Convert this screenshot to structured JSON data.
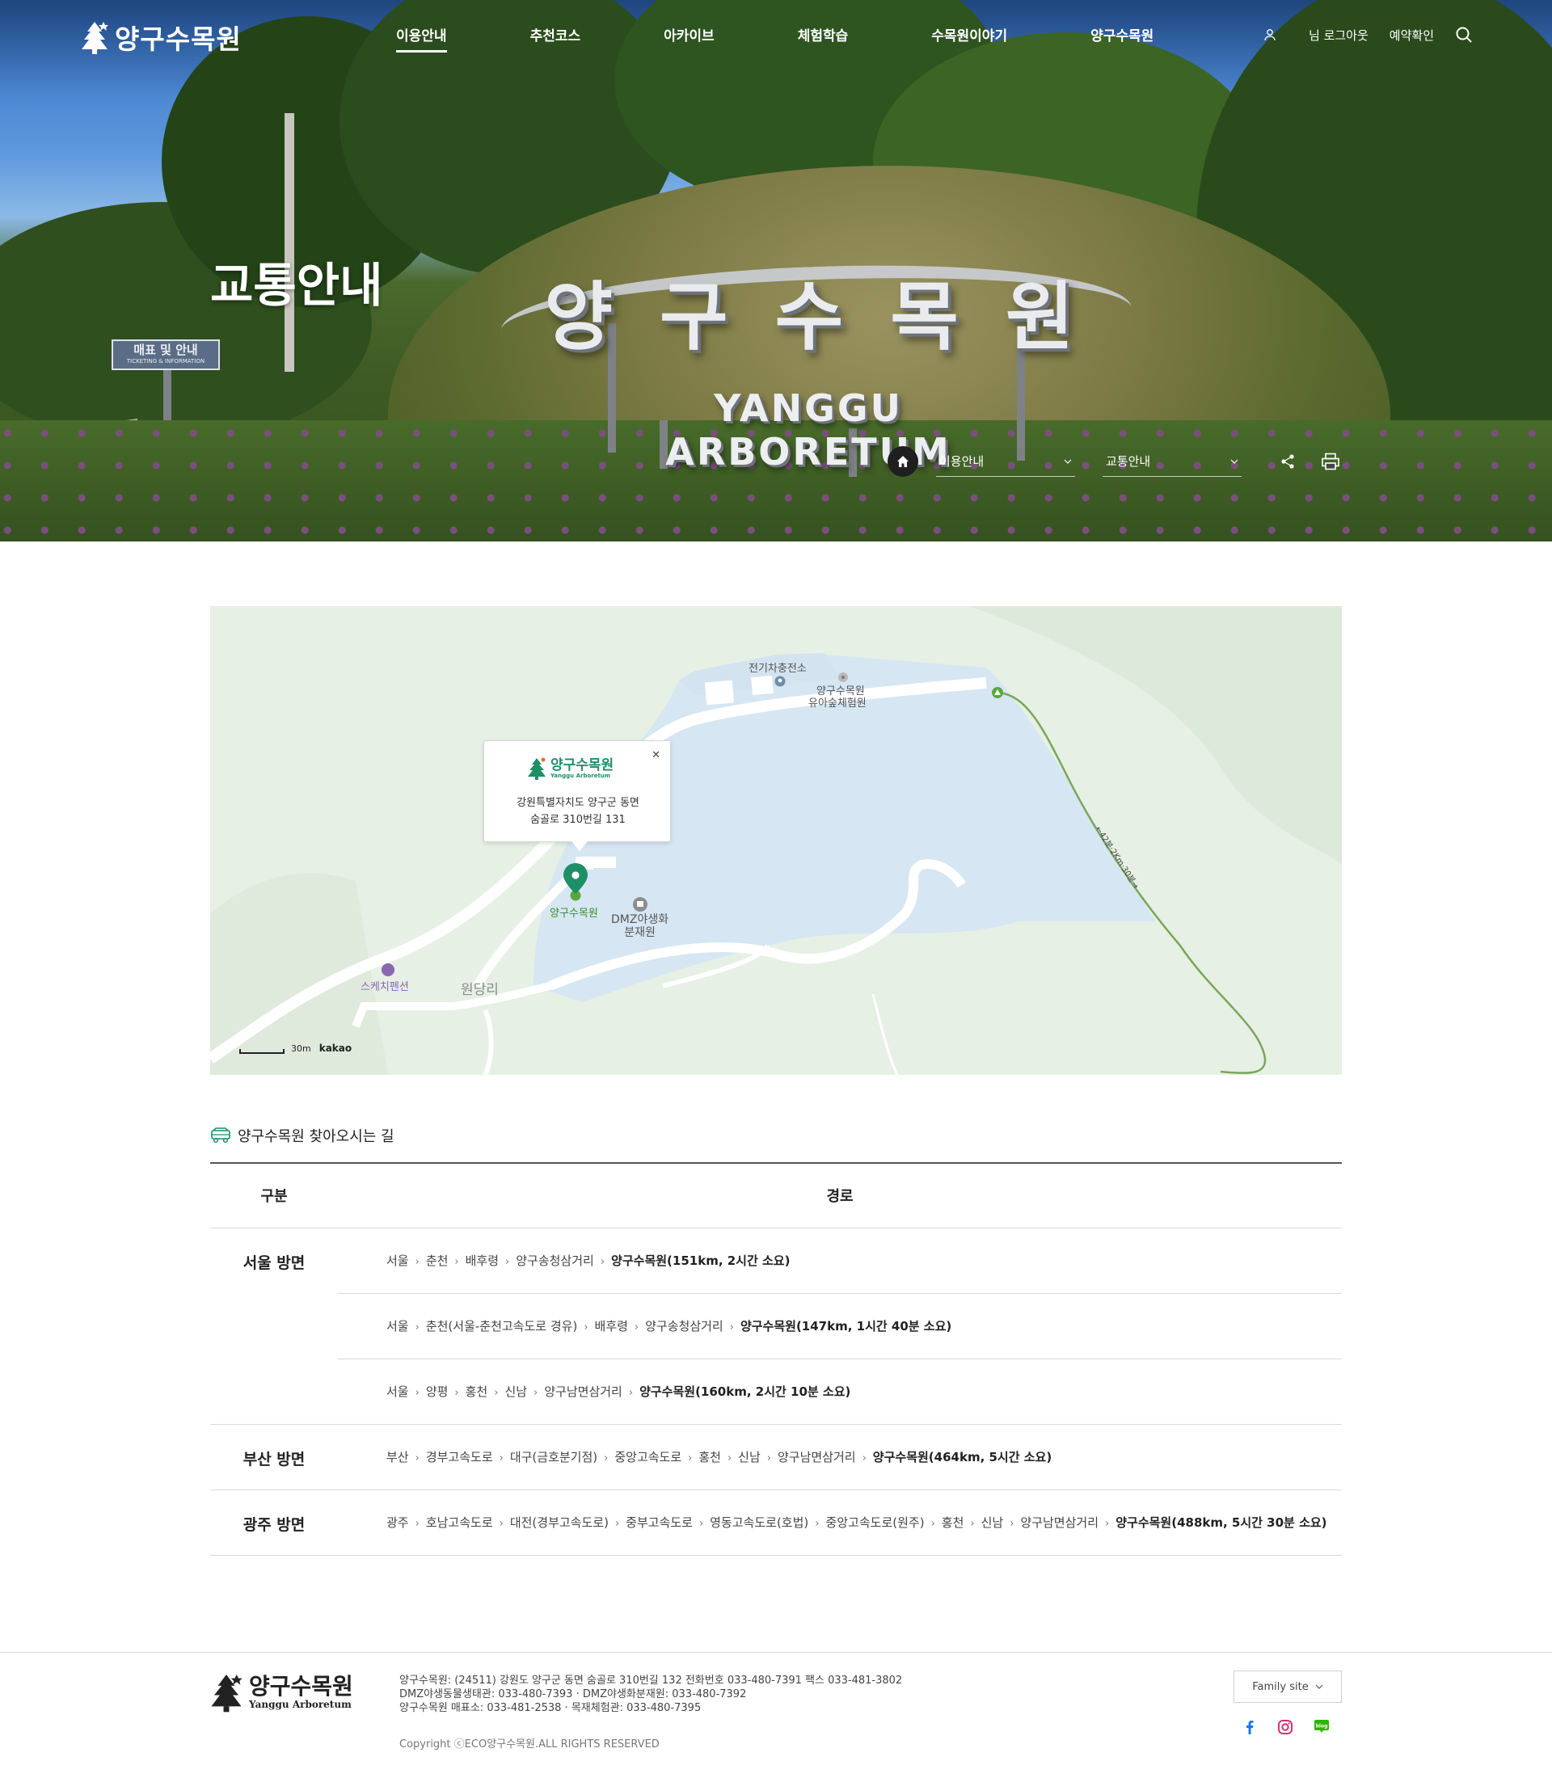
{
  "header": {
    "logo_text": "양구수목원",
    "nav": [
      "이용안내",
      "추천코스",
      "아카이브",
      "체험학습",
      "수목원이야기",
      "양구수목원"
    ],
    "active_nav": "이용안내",
    "util": {
      "logout": "님 로그아웃",
      "reservation": "예약확인"
    }
  },
  "hero": {
    "title": "교통안내",
    "sign_korean": "양구수목원",
    "sign_english": "YANGGU ARBORETUM",
    "road_sign_ko": "매표 및 안내",
    "road_sign_en": "TICKETING & INFORMATION"
  },
  "breadcrumb": {
    "level1": "이용안내",
    "level2": "교통안내"
  },
  "map": {
    "popup": {
      "logo_title": "양구수목원",
      "logo_sub": "Yanggu Arboretum",
      "address_line1": "강원특별자치도 양구군 동면",
      "address_line2": "숨골로 310번길 131"
    },
    "labels": {
      "charger": "전기차충전소",
      "forest_school_1": "양구수목원",
      "forest_school_2": "유아숲체험원",
      "arboretum": "양구수목원",
      "dmz_1": "DMZ야생화",
      "dmz_2": "분재원",
      "pension": "스케치펜션",
      "village": "원당리",
      "trail": "←42분·2Km·30분→"
    },
    "scale_text": "30m",
    "provider": "kakao"
  },
  "routes": {
    "section_title": "양구수목원 찾아오시는 길",
    "col_region": "구분",
    "col_path": "경로",
    "rows": [
      {
        "region": "서울 방면",
        "steps": [
          "서울",
          "춘천",
          "배후령",
          "양구송청삼거리"
        ],
        "dest": "양구수목원(151km, 2시간 소요)"
      },
      {
        "region": "",
        "steps": [
          "서울",
          "춘천(서울-춘천고속도로 경유)",
          "배후령",
          "양구송청삼거리"
        ],
        "dest": "양구수목원(147km, 1시간 40분 소요)"
      },
      {
        "region": "",
        "steps": [
          "서울",
          "양평",
          "홍천",
          "신남",
          "양구남면삼거리"
        ],
        "dest": "양구수목원(160km, 2시간 10분 소요)"
      },
      {
        "region": "부산 방면",
        "steps": [
          "부산",
          "경부고속도로",
          "대구(금호분기점)",
          "중앙고속도로",
          "홍천",
          "신남",
          "양구남면삼거리"
        ],
        "dest": "양구수목원(464km, 5시간 소요)"
      },
      {
        "region": "광주 방면",
        "steps": [
          "광주",
          "호남고속도로",
          "대전(경부고속도로)",
          "중부고속도로",
          "영동고속도로(호법)",
          "중앙고속도로(원주)",
          "홍천",
          "신남",
          "양구남면삼거리"
        ],
        "dest": "양구수목원(488km, 5시간 30분 소요)"
      }
    ]
  },
  "footer": {
    "logo_title": "양구수목원",
    "logo_sub": "Yanggu Arboretum",
    "info_line1": "양구수목원: (24511) 강원도 양구군 동면 숨골로 310번길 132 전화번호 033-480-7391 팩스 033-481-3802",
    "info_line2": "DMZ야생동물생태관: 033-480-7393 · DMZ야생화분재원: 033-480-7392",
    "info_line3": "양구수목원 매표소: 033-481-2538 · 목재체험관: 033-480-7395",
    "copyright": "Copyright ⓒECO양구수목원.ALL RIGHTS RESERVED",
    "family_site": "Family site",
    "sns": [
      "facebook-icon",
      "instagram-icon",
      "blog-icon"
    ]
  },
  "colors": {
    "accent_green": "#1e8f67",
    "map_water": "#d6e6f3",
    "map_land": "#e6f0e4",
    "trail_green": "#7aa65a"
  }
}
